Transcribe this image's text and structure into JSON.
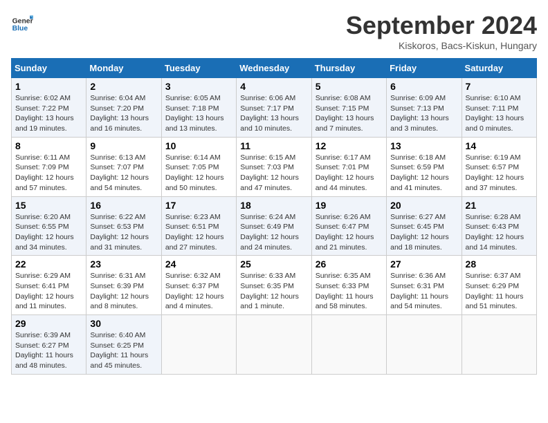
{
  "header": {
    "logo_line1": "General",
    "logo_line2": "Blue",
    "month_year": "September 2024",
    "location": "Kiskoros, Bacs-Kiskun, Hungary"
  },
  "days_of_week": [
    "Sunday",
    "Monday",
    "Tuesday",
    "Wednesday",
    "Thursday",
    "Friday",
    "Saturday"
  ],
  "weeks": [
    [
      {
        "day": "1",
        "sunrise": "6:02 AM",
        "sunset": "7:22 PM",
        "daylight": "13 hours and 19 minutes."
      },
      {
        "day": "2",
        "sunrise": "6:04 AM",
        "sunset": "7:20 PM",
        "daylight": "13 hours and 16 minutes."
      },
      {
        "day": "3",
        "sunrise": "6:05 AM",
        "sunset": "7:18 PM",
        "daylight": "13 hours and 13 minutes."
      },
      {
        "day": "4",
        "sunrise": "6:06 AM",
        "sunset": "7:17 PM",
        "daylight": "13 hours and 10 minutes."
      },
      {
        "day": "5",
        "sunrise": "6:08 AM",
        "sunset": "7:15 PM",
        "daylight": "13 hours and 7 minutes."
      },
      {
        "day": "6",
        "sunrise": "6:09 AM",
        "sunset": "7:13 PM",
        "daylight": "13 hours and 3 minutes."
      },
      {
        "day": "7",
        "sunrise": "6:10 AM",
        "sunset": "7:11 PM",
        "daylight": "13 hours and 0 minutes."
      }
    ],
    [
      {
        "day": "8",
        "sunrise": "6:11 AM",
        "sunset": "7:09 PM",
        "daylight": "12 hours and 57 minutes."
      },
      {
        "day": "9",
        "sunrise": "6:13 AM",
        "sunset": "7:07 PM",
        "daylight": "12 hours and 54 minutes."
      },
      {
        "day": "10",
        "sunrise": "6:14 AM",
        "sunset": "7:05 PM",
        "daylight": "12 hours and 50 minutes."
      },
      {
        "day": "11",
        "sunrise": "6:15 AM",
        "sunset": "7:03 PM",
        "daylight": "12 hours and 47 minutes."
      },
      {
        "day": "12",
        "sunrise": "6:17 AM",
        "sunset": "7:01 PM",
        "daylight": "12 hours and 44 minutes."
      },
      {
        "day": "13",
        "sunrise": "6:18 AM",
        "sunset": "6:59 PM",
        "daylight": "12 hours and 41 minutes."
      },
      {
        "day": "14",
        "sunrise": "6:19 AM",
        "sunset": "6:57 PM",
        "daylight": "12 hours and 37 minutes."
      }
    ],
    [
      {
        "day": "15",
        "sunrise": "6:20 AM",
        "sunset": "6:55 PM",
        "daylight": "12 hours and 34 minutes."
      },
      {
        "day": "16",
        "sunrise": "6:22 AM",
        "sunset": "6:53 PM",
        "daylight": "12 hours and 31 minutes."
      },
      {
        "day": "17",
        "sunrise": "6:23 AM",
        "sunset": "6:51 PM",
        "daylight": "12 hours and 27 minutes."
      },
      {
        "day": "18",
        "sunrise": "6:24 AM",
        "sunset": "6:49 PM",
        "daylight": "12 hours and 24 minutes."
      },
      {
        "day": "19",
        "sunrise": "6:26 AM",
        "sunset": "6:47 PM",
        "daylight": "12 hours and 21 minutes."
      },
      {
        "day": "20",
        "sunrise": "6:27 AM",
        "sunset": "6:45 PM",
        "daylight": "12 hours and 18 minutes."
      },
      {
        "day": "21",
        "sunrise": "6:28 AM",
        "sunset": "6:43 PM",
        "daylight": "12 hours and 14 minutes."
      }
    ],
    [
      {
        "day": "22",
        "sunrise": "6:29 AM",
        "sunset": "6:41 PM",
        "daylight": "12 hours and 11 minutes."
      },
      {
        "day": "23",
        "sunrise": "6:31 AM",
        "sunset": "6:39 PM",
        "daylight": "12 hours and 8 minutes."
      },
      {
        "day": "24",
        "sunrise": "6:32 AM",
        "sunset": "6:37 PM",
        "daylight": "12 hours and 4 minutes."
      },
      {
        "day": "25",
        "sunrise": "6:33 AM",
        "sunset": "6:35 PM",
        "daylight": "12 hours and 1 minute."
      },
      {
        "day": "26",
        "sunrise": "6:35 AM",
        "sunset": "6:33 PM",
        "daylight": "11 hours and 58 minutes."
      },
      {
        "day": "27",
        "sunrise": "6:36 AM",
        "sunset": "6:31 PM",
        "daylight": "11 hours and 54 minutes."
      },
      {
        "day": "28",
        "sunrise": "6:37 AM",
        "sunset": "6:29 PM",
        "daylight": "11 hours and 51 minutes."
      }
    ],
    [
      {
        "day": "29",
        "sunrise": "6:39 AM",
        "sunset": "6:27 PM",
        "daylight": "11 hours and 48 minutes."
      },
      {
        "day": "30",
        "sunrise": "6:40 AM",
        "sunset": "6:25 PM",
        "daylight": "11 hours and 45 minutes."
      },
      null,
      null,
      null,
      null,
      null
    ]
  ]
}
